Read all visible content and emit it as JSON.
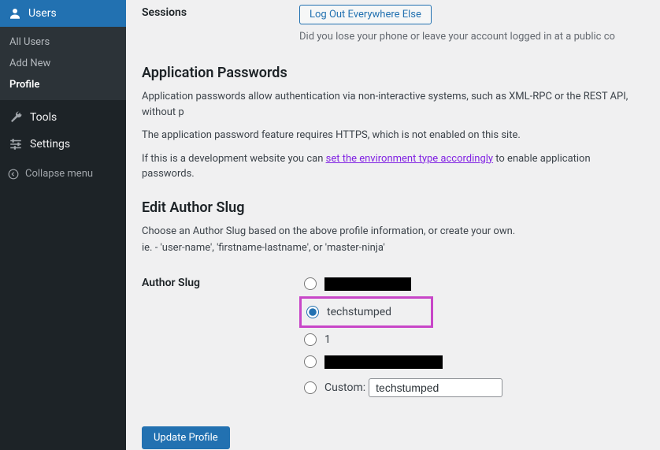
{
  "sidebar": {
    "top": {
      "label": "Users"
    },
    "sub": [
      {
        "label": "All Users"
      },
      {
        "label": "Add New"
      },
      {
        "label": "Profile"
      }
    ],
    "items": [
      {
        "label": "Tools"
      },
      {
        "label": "Settings"
      }
    ],
    "collapse": "Collapse menu"
  },
  "sessions": {
    "label": "Sessions",
    "logout_btn": "Log Out Everywhere Else",
    "desc": "Did you lose your phone or leave your account logged in at a public co"
  },
  "app_passwords": {
    "heading": "Application Passwords",
    "p1": "Application passwords allow authentication via non-interactive systems, such as XML-RPC or the REST API, without p",
    "p2": "The application password feature requires HTTPS, which is not enabled on this site.",
    "p3a": "If this is a development website you can ",
    "p3_link": "set the environment type accordingly",
    "p3b": " to enable application passwords."
  },
  "slug": {
    "heading": "Edit Author Slug",
    "desc1": "Choose an Author Slug based on the above profile information, or create your own.",
    "desc2": "ie. - 'user-name', 'firstname-lastname', or 'master-ninja'",
    "label": "Author Slug",
    "options": {
      "opt1": "",
      "opt2": "techstumped",
      "opt3": "1",
      "opt4": "",
      "custom_label": "Custom:",
      "custom_value": "techstumped"
    }
  },
  "submit": "Update Profile"
}
